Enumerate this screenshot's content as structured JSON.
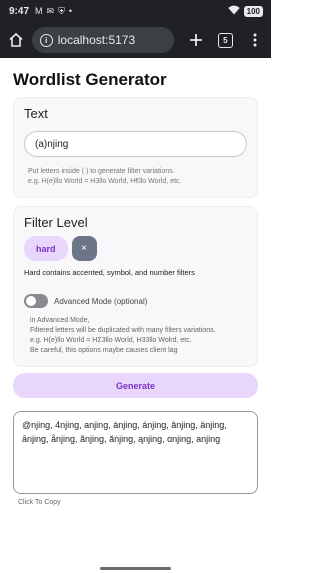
{
  "status_bar": {
    "time": "9:47",
    "notif_icons": [
      "M",
      "mail-icon",
      "shield-icon",
      "•"
    ],
    "battery": "100"
  },
  "browser": {
    "url": "localhost:5173",
    "tab_count": "5"
  },
  "page_title": "Wordlist Generator",
  "text_section": {
    "title": "Text",
    "input_value": "(a)njing",
    "hint_line1": "Put letters inside ( ) to generate filter variations.",
    "hint_line2": "e.g. H(e)llo World = H3llo World, H€llo World, etc."
  },
  "filter_section": {
    "title": "Filter Level",
    "selected_chip": "hard",
    "close_symbol": "×",
    "description": "Hard contains accented, symbol, and number filters",
    "advanced_label": "Advanced Mode (optional)",
    "advanced_enabled": false,
    "adv_hint_lines": [
      "in Advanced Mode,",
      "Filtered letters will be duplicated with many filters variations.",
      "e.g. H(e)llo World = HΣ3llo World, H33llo Wolrd, etc.",
      "Be careful, this options maybe causes client lag"
    ]
  },
  "generate_label": "Generate",
  "output": {
    "text": "@njing, 4njing, anjing, ànjing, ánjing, ânjing, änjing, ānjing, ånjing, ãnjing, ăṅjing, ąnjing, ɑnjing, anjing",
    "copy_hint": "Click To Copy"
  },
  "colors": {
    "accent": "#7a34c4",
    "accent_bg": "#e9d6fc",
    "chrome_bg": "#202124"
  }
}
